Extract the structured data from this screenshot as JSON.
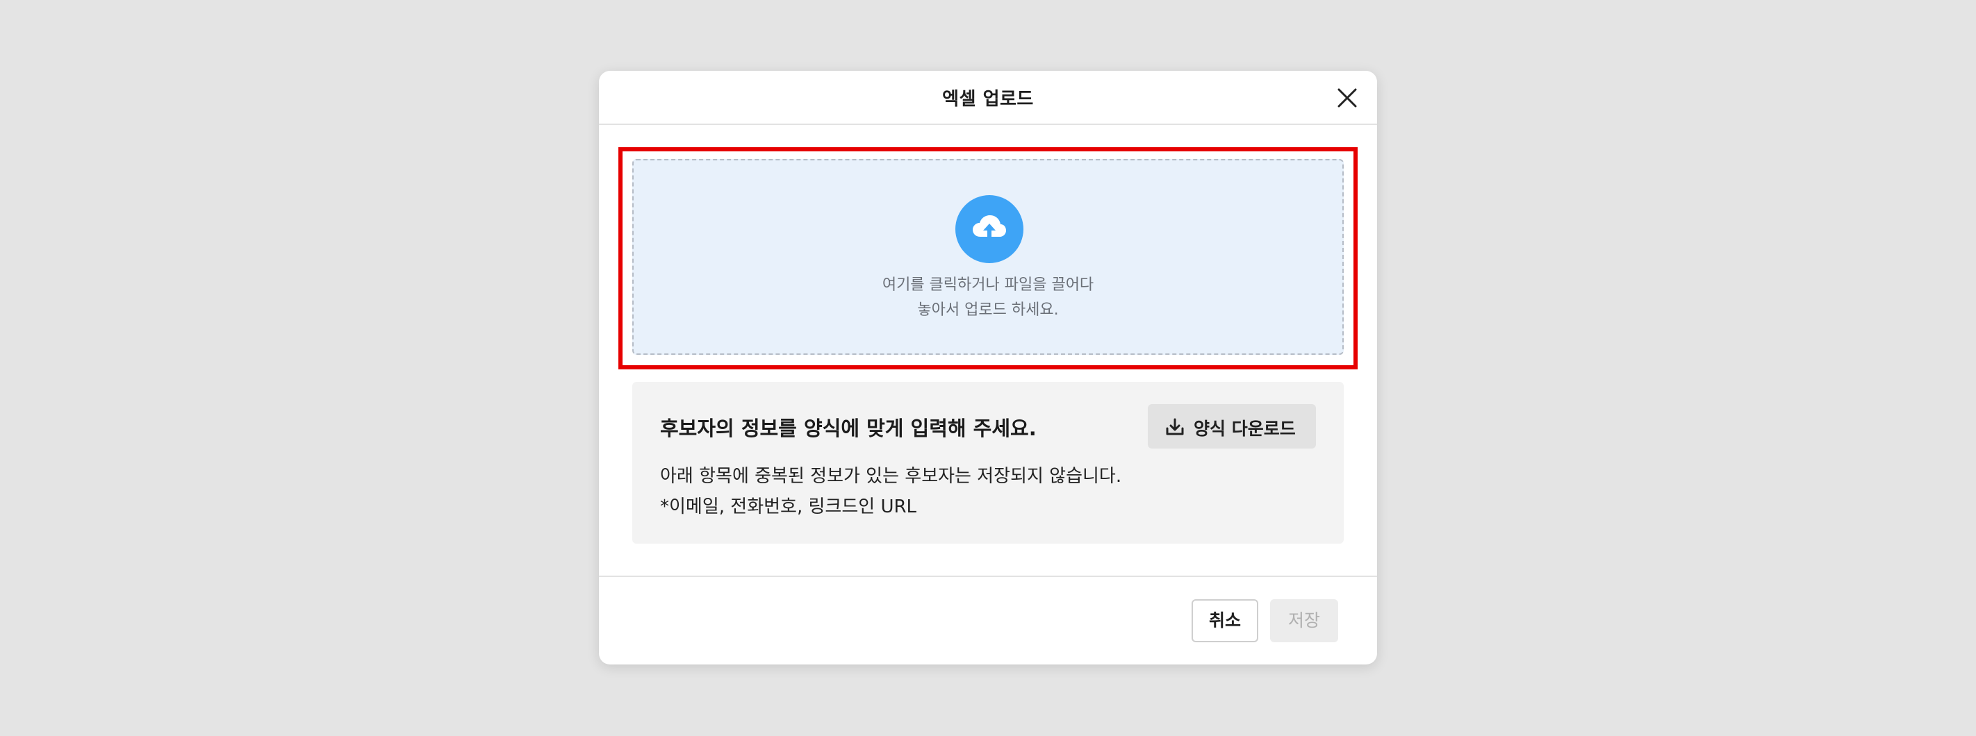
{
  "modal": {
    "title": "엑셀 업로드"
  },
  "dropzone": {
    "line1": "여기를 클릭하거나 파일을 끌어다",
    "line2": "놓아서 업로드 하세요.",
    "icon": "cloud-upload-icon"
  },
  "info": {
    "title": "후보자의 정보를 양식에 맞게 입력해 주세요.",
    "download_label": "양식 다운로드",
    "desc_line1": "아래 항목에 중복된 정보가 있는 후보자는 저장되지 않습니다.",
    "desc_line2": "*이메일, 전화번호, 링크드인 URL"
  },
  "footer": {
    "cancel_label": "취소",
    "save_label": "저장"
  },
  "colors": {
    "accent": "#3ea4f6",
    "highlight_border": "#e60000",
    "dropzone_bg": "#e8f1fb"
  }
}
